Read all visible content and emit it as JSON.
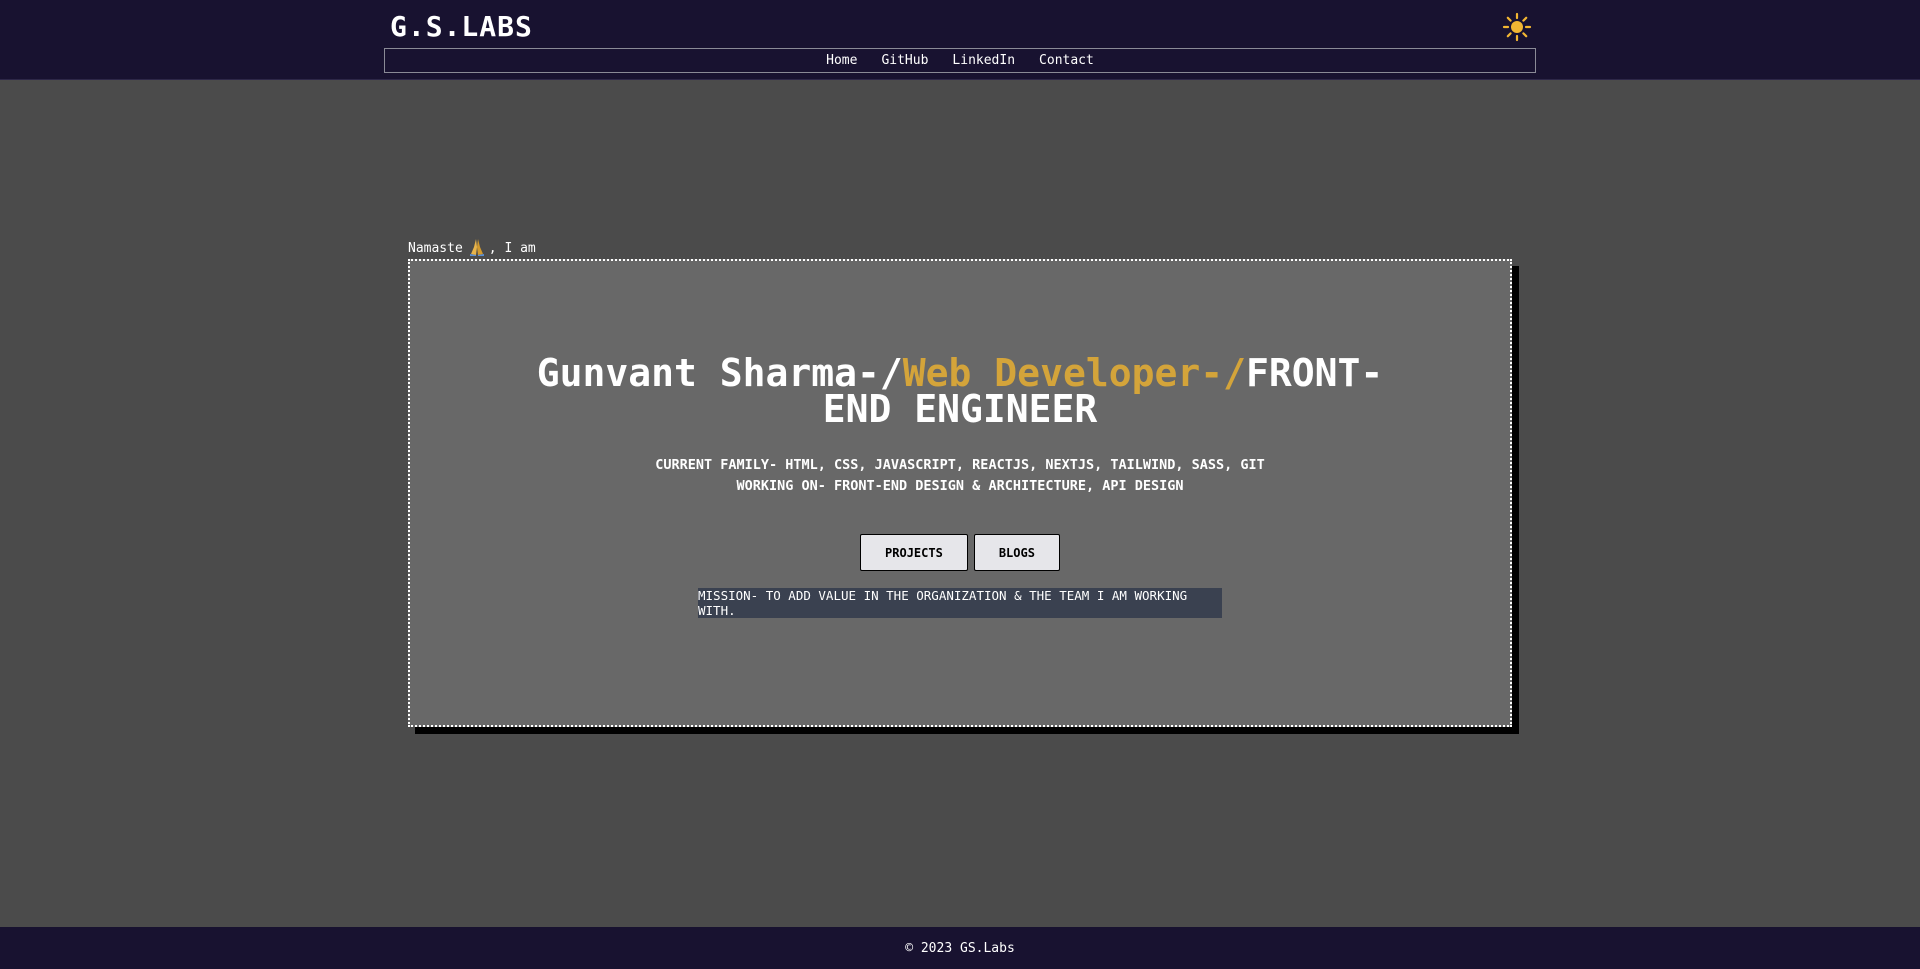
{
  "header": {
    "logo": "G.S.LABS",
    "theme_toggle_icon": "sun-icon",
    "nav": [
      {
        "label": "Home"
      },
      {
        "label": "GitHub"
      },
      {
        "label": "LinkedIn"
      },
      {
        "label": "Contact"
      }
    ]
  },
  "hero": {
    "greeting_prefix": "Namaste",
    "greeting_icon": "folded-hands-icon",
    "greeting_suffix": ", I am",
    "name": "Gunvant Sharma-/",
    "role": "Web Developer-/",
    "title": "FRONT-END ENGINEER",
    "current_family": "CURRENT FAMILY- HTML, CSS, JAVASCRIPT, REACTJS, NEXTJS, TAILWIND, SASS, GIT",
    "working_on": "WORKING ON- FRONT-END DESIGN & ARCHITECTURE, API DESIGN",
    "projects_button": "PROJECTS",
    "blogs_button": "BLOGS",
    "mission": "MISSION- TO ADD VALUE IN THE ORGANIZATION & THE TEAM I AM WORKING WITH."
  },
  "footer": {
    "copyright": "© 2023 GS.Labs"
  },
  "colors": {
    "background": "#4b4b4b",
    "header": "#181230",
    "card": "#686868",
    "accent": "#d4a43a",
    "mission_bg": "#3a4150"
  }
}
